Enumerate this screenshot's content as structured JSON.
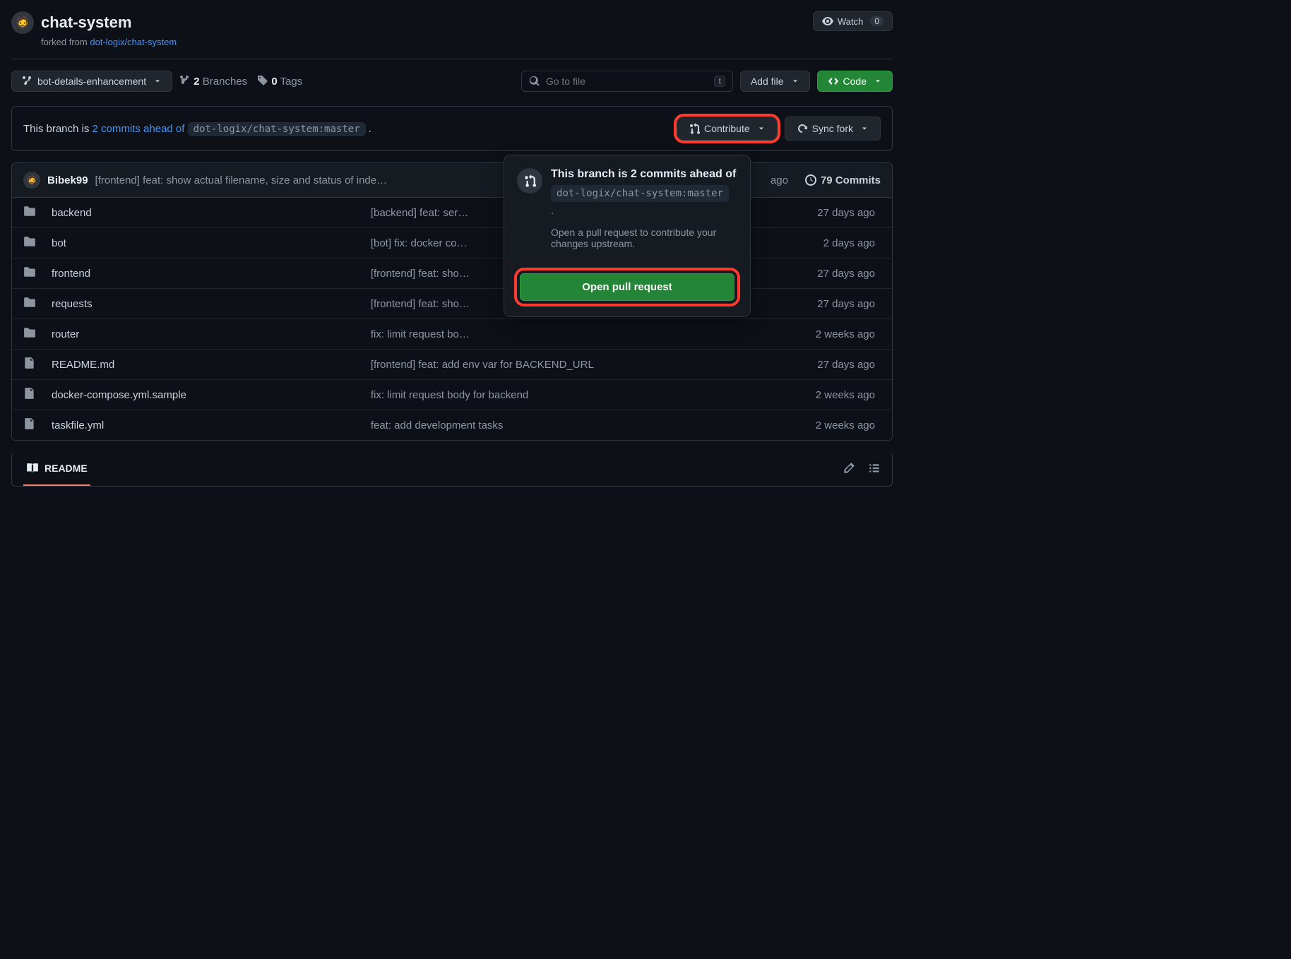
{
  "header": {
    "repo_name": "chat-system",
    "forked_prefix": "forked from ",
    "forked_link": "dot-logix/chat-system",
    "watch_label": "Watch",
    "watch_count": "0"
  },
  "toolbar": {
    "branch_name": "bot-details-enhancement",
    "branches_count": "2",
    "branches_label": " Branches",
    "tags_count": "0",
    "tags_label": " Tags",
    "search_placeholder": "Go to file",
    "search_kbd": "t",
    "add_file_label": "Add file",
    "code_label": "Code"
  },
  "status": {
    "prefix": "This branch is ",
    "ahead_link": "2 commits ahead of",
    "code_ref": "dot-logix/chat-system:master",
    "suffix": " .",
    "contribute_label": "Contribute",
    "sync_label": "Sync fork"
  },
  "popover": {
    "title": "This branch is 2 commits ahead of",
    "code_ref": "dot-logix/chat-system:master",
    "dot": ".",
    "desc": "Open a pull request to contribute your changes upstream.",
    "button": "Open pull request"
  },
  "latest_commit": {
    "author": "Bibek99",
    "message": "[frontend] feat: show actual filename, size and status of inde…",
    "time_suffix": "ago",
    "commits_count": "79 Commits"
  },
  "files": [
    {
      "type": "dir",
      "name": "backend",
      "msg": "[backend] feat: ser…",
      "time": "27 days ago"
    },
    {
      "type": "dir",
      "name": "bot",
      "msg": "[bot] fix: docker co…",
      "time": "2 days ago"
    },
    {
      "type": "dir",
      "name": "frontend",
      "msg": "[frontend] feat: sho…",
      "time": "27 days ago"
    },
    {
      "type": "dir",
      "name": "requests",
      "msg": "[frontend] feat: sho…",
      "time": "27 days ago"
    },
    {
      "type": "dir",
      "name": "router",
      "msg": "fix: limit request bo…",
      "time": "2 weeks ago"
    },
    {
      "type": "file",
      "name": "README.md",
      "msg": "[frontend] feat: add env var for BACKEND_URL",
      "time": "27 days ago"
    },
    {
      "type": "file",
      "name": "docker-compose.yml.sample",
      "msg": "fix: limit request body for backend",
      "time": "2 weeks ago"
    },
    {
      "type": "file",
      "name": "taskfile.yml",
      "msg": "feat: add development tasks",
      "time": "2 weeks ago"
    }
  ],
  "readme": {
    "tab_label": "README"
  }
}
